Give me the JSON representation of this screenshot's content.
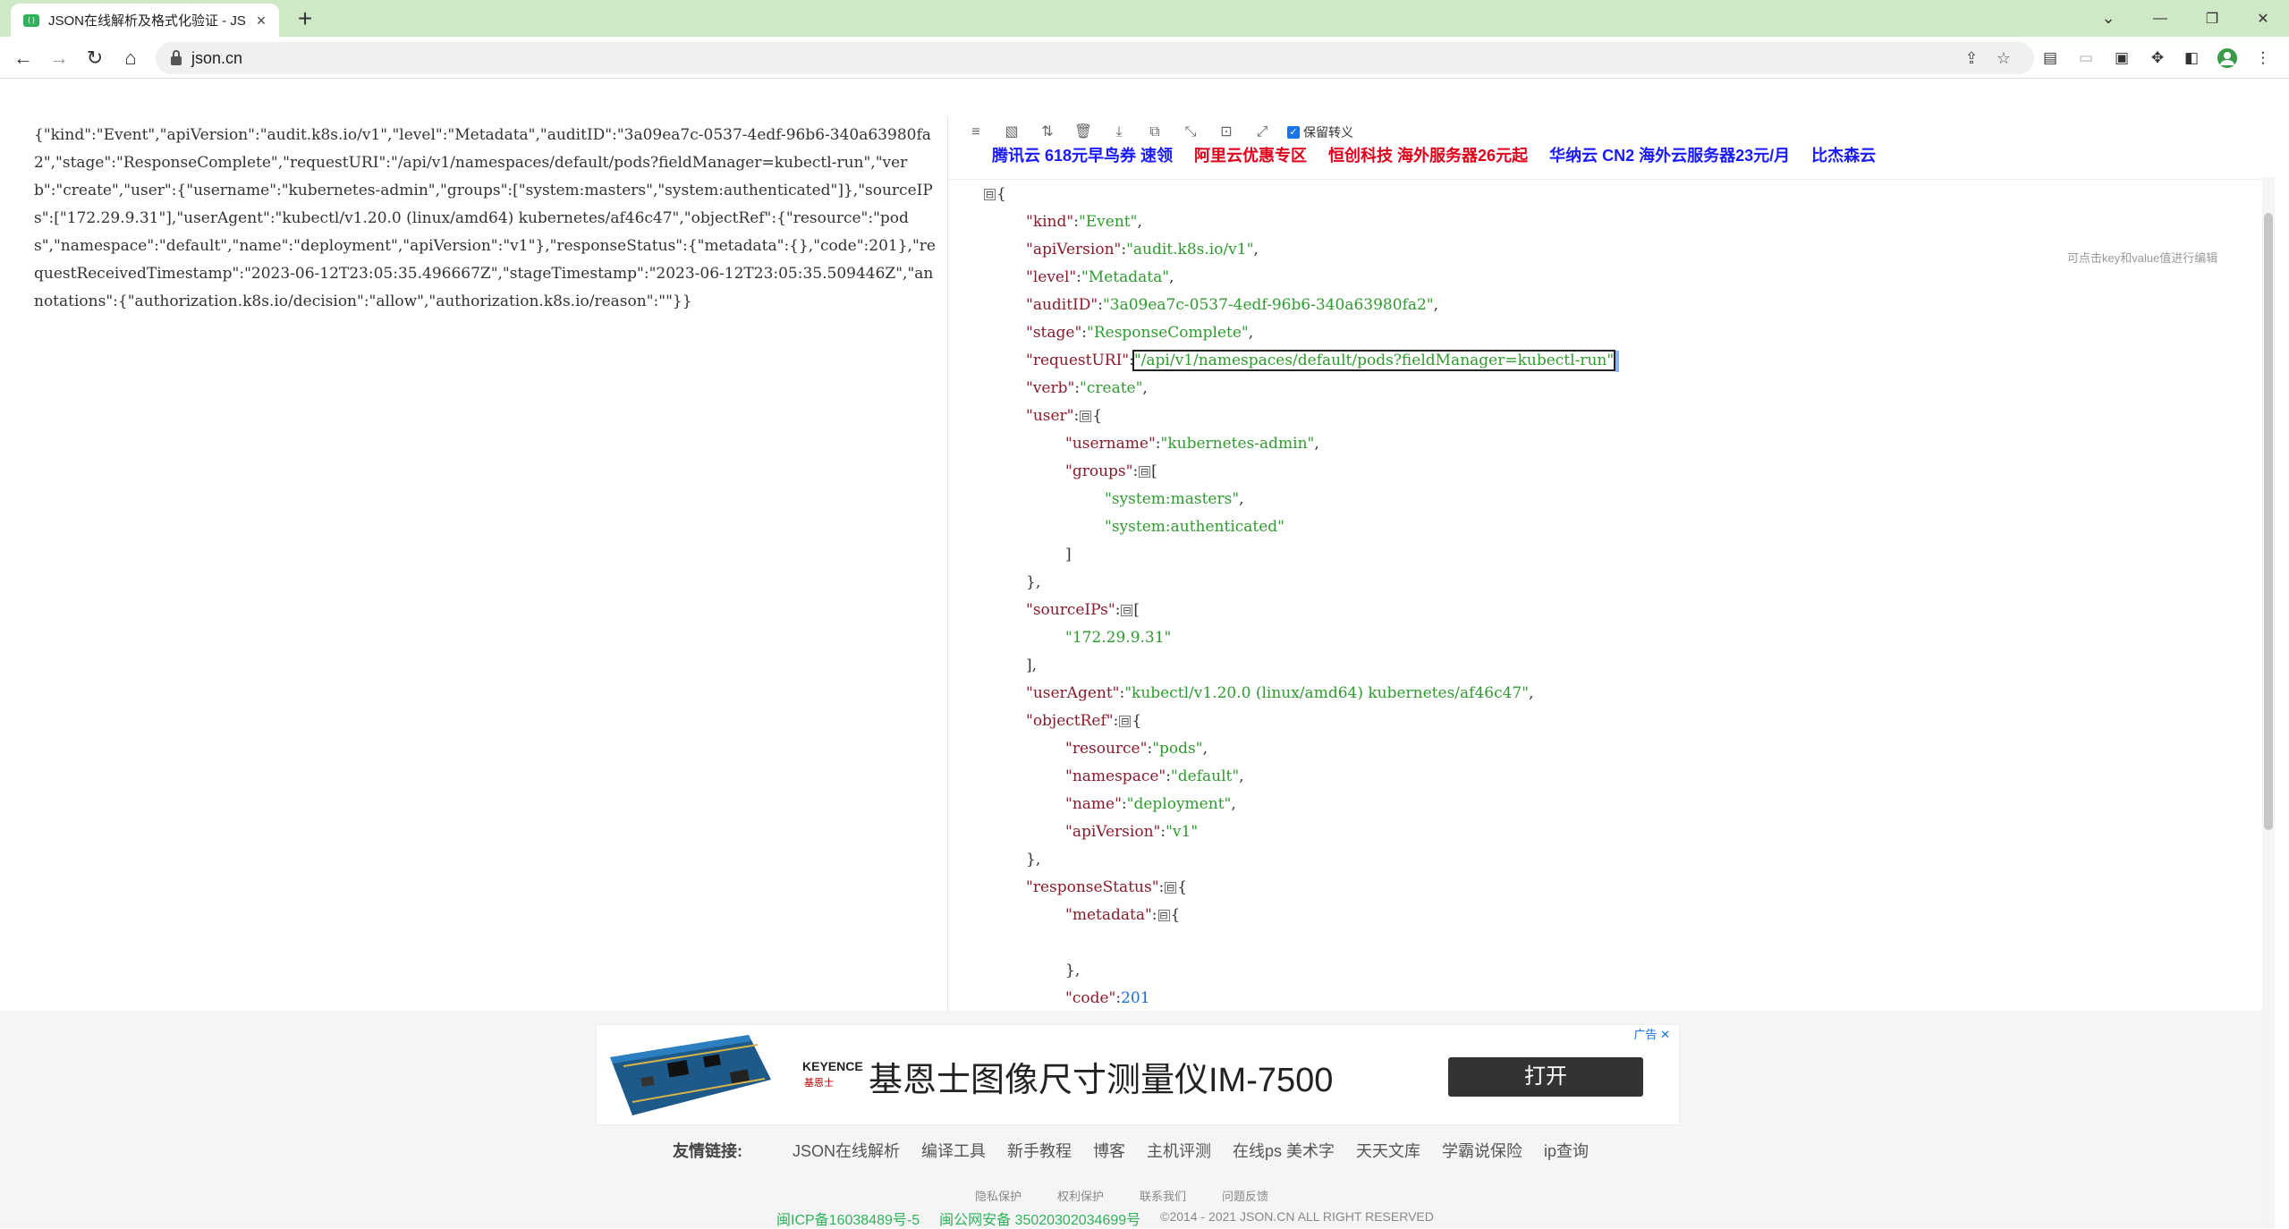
{
  "browser": {
    "tab_title": "JSON在线解析及格式化验证 - JS",
    "url": "json.cn",
    "new_tab": "+",
    "win_minimize": "—",
    "win_restore": "❐",
    "win_close": "✕"
  },
  "editor": {
    "raw_text": "{\"kind\":\"Event\",\"apiVersion\":\"audit.k8s.io/v1\",\"level\":\"Metadata\",\"auditID\":\"3a09ea7c-0537-4edf-96b6-340a63980fa2\",\"stage\":\"ResponseComplete\",\"requestURI\":\"/api/v1/namespaces/default/pods?fieldManager=kubectl-run\",\"verb\":\"create\",\"user\":{\"username\":\"kubernetes-admin\",\"groups\":[\"system:masters\",\"system:authenticated\"]},\"sourceIPs\":[\"172.29.9.31\"],\"userAgent\":\"kubectl/v1.20.0 (linux/amd64) kubernetes/af46c47\",\"objectRef\":{\"resource\":\"pods\",\"namespace\":\"default\",\"name\":\"deployment\",\"apiVersion\":\"v1\"},\"responseStatus\":{\"metadata\":{},\"code\":201},\"requestReceivedTimestamp\":\"2023-06-12T23:05:35.496667Z\",\"stageTimestamp\":\"2023-06-12T23:05:35.509446Z\",\"annotations\":{\"authorization.k8s.io/decision\":\"allow\",\"authorization.k8s.io/reason\":\"\"}}"
  },
  "viewer": {
    "keep_escape_label": "保留转义",
    "hint": "可点击key和value值进行编辑",
    "ad_links": [
      {
        "text": "腾讯云 618元早鸟券 速领",
        "color": "#1a1aff"
      },
      {
        "text": "阿里云优惠专区",
        "color": "#e0001b"
      },
      {
        "text": "恒创科技 海外服务器26元起",
        "color": "#e0001b"
      },
      {
        "text": "华纳云 CN2 海外云服务器23元/月",
        "color": "#1a1aff"
      },
      {
        "text": "比杰森云",
        "color": "#1a1aff"
      }
    ],
    "lines": [
      {
        "indent": 0,
        "parts": [
          [
            "tg",
            "⊟"
          ],
          [
            "p",
            "{"
          ]
        ]
      },
      {
        "indent": 1,
        "parts": [
          [
            "k",
            "\"kind\""
          ],
          [
            "p",
            ":"
          ],
          [
            "s",
            "\"Event\""
          ],
          [
            "p",
            ","
          ]
        ]
      },
      {
        "indent": 1,
        "parts": [
          [
            "k",
            "\"apiVersion\""
          ],
          [
            "p",
            ":"
          ],
          [
            "s",
            "\"audit.k8s.io/v1\""
          ],
          [
            "p",
            ","
          ]
        ]
      },
      {
        "indent": 1,
        "parts": [
          [
            "k",
            "\"level\""
          ],
          [
            "p",
            ":"
          ],
          [
            "s",
            "\"Metadata\""
          ],
          [
            "p",
            ","
          ]
        ]
      },
      {
        "indent": 1,
        "parts": [
          [
            "k",
            "\"auditID\""
          ],
          [
            "p",
            ":"
          ],
          [
            "s",
            "\"3a09ea7c-0537-4edf-96b6-340a63980fa2\""
          ],
          [
            "p",
            ","
          ]
        ]
      },
      {
        "indent": 1,
        "parts": [
          [
            "k",
            "\"stage\""
          ],
          [
            "p",
            ":"
          ],
          [
            "s",
            "\"ResponseComplete\""
          ],
          [
            "p",
            ","
          ]
        ]
      },
      {
        "indent": 1,
        "parts": [
          [
            "k",
            "\"requestURI\""
          ],
          [
            "p",
            ":"
          ],
          [
            "sel",
            "\"/api/v1/namespaces/default/pods?fieldManager=kubectl-run\""
          ],
          [
            "caret",
            ""
          ]
        ]
      },
      {
        "indent": 1,
        "parts": [
          [
            "k",
            "\"verb\""
          ],
          [
            "p",
            ":"
          ],
          [
            "s",
            "\"create\""
          ],
          [
            "p",
            ","
          ]
        ]
      },
      {
        "indent": 1,
        "parts": [
          [
            "k",
            "\"user\""
          ],
          [
            "p",
            ":"
          ],
          [
            "tg",
            "⊟"
          ],
          [
            "p",
            "{"
          ]
        ]
      },
      {
        "indent": 2,
        "parts": [
          [
            "k",
            "\"username\""
          ],
          [
            "p",
            ":"
          ],
          [
            "s",
            "\"kubernetes-admin\""
          ],
          [
            "p",
            ","
          ]
        ]
      },
      {
        "indent": 2,
        "parts": [
          [
            "k",
            "\"groups\""
          ],
          [
            "p",
            ":"
          ],
          [
            "tg",
            "⊟"
          ],
          [
            "p",
            "["
          ]
        ]
      },
      {
        "indent": 3,
        "parts": [
          [
            "s",
            "\"system:masters\""
          ],
          [
            "p",
            ","
          ]
        ]
      },
      {
        "indent": 3,
        "parts": [
          [
            "s",
            "\"system:authenticated\""
          ]
        ]
      },
      {
        "indent": 2,
        "parts": [
          [
            "p",
            "]"
          ]
        ]
      },
      {
        "indent": 1,
        "parts": [
          [
            "p",
            "},"
          ]
        ]
      },
      {
        "indent": 1,
        "parts": [
          [
            "k",
            "\"sourceIPs\""
          ],
          [
            "p",
            ":"
          ],
          [
            "tg",
            "⊟"
          ],
          [
            "p",
            "["
          ]
        ]
      },
      {
        "indent": 2,
        "parts": [
          [
            "s",
            "\"172.29.9.31\""
          ]
        ]
      },
      {
        "indent": 1,
        "parts": [
          [
            "p",
            "],"
          ]
        ]
      },
      {
        "indent": 1,
        "parts": [
          [
            "k",
            "\"userAgent\""
          ],
          [
            "p",
            ":"
          ],
          [
            "s",
            "\"kubectl/v1.20.0 (linux/amd64) kubernetes/af46c47\""
          ],
          [
            "p",
            ","
          ]
        ]
      },
      {
        "indent": 1,
        "parts": [
          [
            "k",
            "\"objectRef\""
          ],
          [
            "p",
            ":"
          ],
          [
            "tg",
            "⊟"
          ],
          [
            "p",
            "{"
          ]
        ]
      },
      {
        "indent": 2,
        "parts": [
          [
            "k",
            "\"resource\""
          ],
          [
            "p",
            ":"
          ],
          [
            "s",
            "\"pods\""
          ],
          [
            "p",
            ","
          ]
        ]
      },
      {
        "indent": 2,
        "parts": [
          [
            "k",
            "\"namespace\""
          ],
          [
            "p",
            ":"
          ],
          [
            "s",
            "\"default\""
          ],
          [
            "p",
            ","
          ]
        ]
      },
      {
        "indent": 2,
        "parts": [
          [
            "k",
            "\"name\""
          ],
          [
            "p",
            ":"
          ],
          [
            "s",
            "\"deployment\""
          ],
          [
            "p",
            ","
          ]
        ]
      },
      {
        "indent": 2,
        "parts": [
          [
            "k",
            "\"apiVersion\""
          ],
          [
            "p",
            ":"
          ],
          [
            "s",
            "\"v1\""
          ]
        ]
      },
      {
        "indent": 1,
        "parts": [
          [
            "p",
            "},"
          ]
        ]
      },
      {
        "indent": 1,
        "parts": [
          [
            "k",
            "\"responseStatus\""
          ],
          [
            "p",
            ":"
          ],
          [
            "tg",
            "⊟"
          ],
          [
            "p",
            "{"
          ]
        ]
      },
      {
        "indent": 2,
        "parts": [
          [
            "k",
            "\"metadata\""
          ],
          [
            "p",
            ":"
          ],
          [
            "tg",
            "⊟"
          ],
          [
            "p",
            "{"
          ]
        ]
      },
      {
        "indent": 2,
        "parts": []
      },
      {
        "indent": 2,
        "parts": [
          [
            "p",
            "},"
          ]
        ]
      },
      {
        "indent": 2,
        "parts": [
          [
            "k",
            "\"code\""
          ],
          [
            "p",
            ":"
          ],
          [
            "n",
            "201"
          ]
        ]
      }
    ]
  },
  "ad": {
    "brand": "KEYENCE",
    "brand_cn": "基恩士",
    "headline": "基恩士图像尺寸测量仪IM-7500",
    "open_button": "打开",
    "ad_tag": "广告 ✕"
  },
  "footer": {
    "friend_label": "友情链接:",
    "friend_links": [
      "JSON在线解析",
      "编译工具",
      "新手教程",
      "博客",
      "主机评测",
      "在线ps 美术字",
      "天天文库",
      "学霸说保险",
      "ip查询"
    ],
    "small_links": [
      "隐私保护",
      "权利保护",
      "联系我们",
      "问题反馈"
    ],
    "icp": "闽ICP备16038489号-5",
    "police": "闽公网安备 35020302034699号",
    "copyright": "©2014 - 2021 JSON.CN ALL RIGHT RESERVED"
  }
}
